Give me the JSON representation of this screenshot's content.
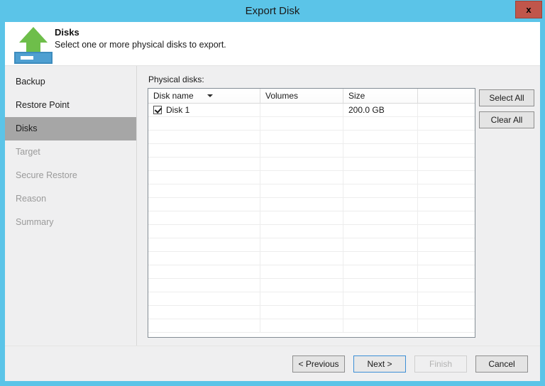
{
  "window": {
    "title": "Export Disk",
    "close_label": "x",
    "close_icon": "close-icon",
    "accent_color": "#5bc4e8",
    "close_color": "#c0564b"
  },
  "header": {
    "icon": "export-disk-icon",
    "title": "Disks",
    "subtitle": "Select one or more physical disks to export."
  },
  "sidebar": {
    "items": [
      {
        "label": "Backup",
        "state": "done"
      },
      {
        "label": "Restore Point",
        "state": "done"
      },
      {
        "label": "Disks",
        "state": "active"
      },
      {
        "label": "Target",
        "state": "future"
      },
      {
        "label": "Secure Restore",
        "state": "future"
      },
      {
        "label": "Reason",
        "state": "future"
      },
      {
        "label": "Summary",
        "state": "future"
      }
    ]
  },
  "main": {
    "field_label": "Physical disks:",
    "table": {
      "columns": [
        "Disk name",
        "Volumes",
        "Size",
        ""
      ],
      "sort_column": "Disk name",
      "sort_direction": "descending",
      "rows": [
        {
          "checked": true,
          "disk_name": "Disk 1",
          "volumes": "",
          "size": "200.0 GB",
          "extra": ""
        }
      ],
      "empty_row_count": 16
    },
    "side_buttons": [
      {
        "label": "Select All",
        "name": "select-all-button"
      },
      {
        "label": "Clear All",
        "name": "clear-all-button"
      }
    ]
  },
  "footer": {
    "buttons": [
      {
        "label": "< Previous",
        "name": "previous-button",
        "state": "enabled"
      },
      {
        "label": "Next >",
        "name": "next-button",
        "state": "focused"
      },
      {
        "label": "Finish",
        "name": "finish-button",
        "state": "disabled"
      },
      {
        "label": "Cancel",
        "name": "cancel-button",
        "state": "enabled"
      }
    ]
  }
}
